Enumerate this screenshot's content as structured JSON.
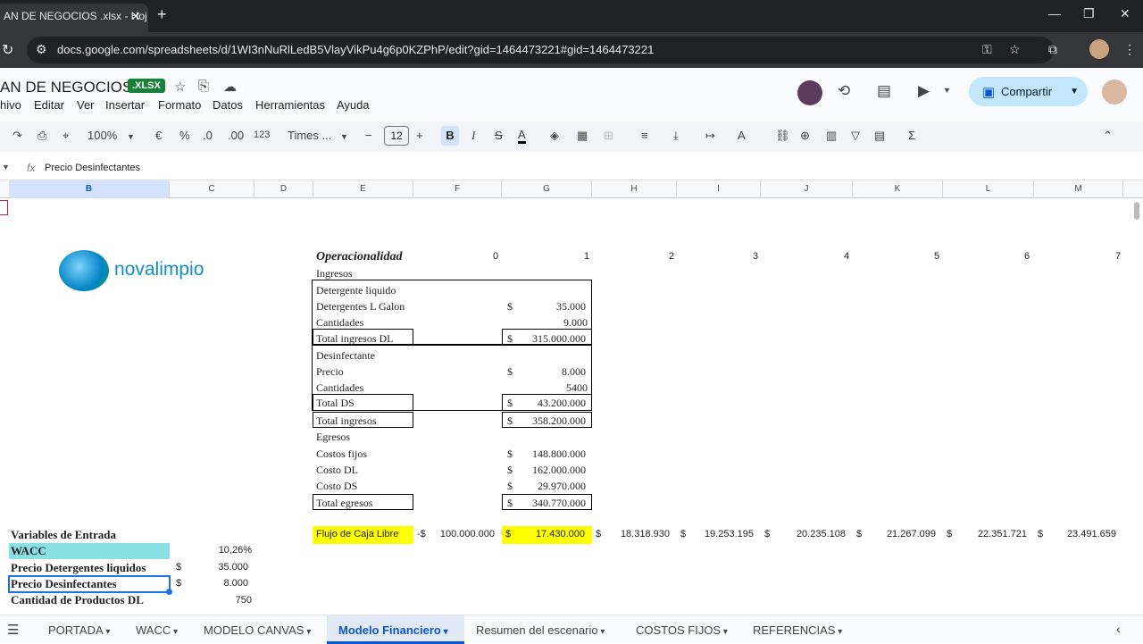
{
  "browser": {
    "tab_title": "AN DE NEGOCIOS .xlsx - Hoj",
    "url": "docs.google.com/spreadsheets/d/1WI3nNuRlLedB5VlayVikPu4g6p0KZPhP/edit?gid=1464473221#gid=1464473221"
  },
  "doc": {
    "title": "AN DE NEGOCIOS",
    "badge": ".XLSX",
    "share_label": "Compartir",
    "menus": [
      "hivo",
      "Editar",
      "Ver",
      "Insertar",
      "Formato",
      "Datos",
      "Herramientas",
      "Ayuda"
    ]
  },
  "toolbar": {
    "zoom": "100%",
    "currency": "€",
    "percent": "%",
    "dec_less": ".0",
    "dec_more": ".00",
    "number_fmt": "123",
    "font": "Times ...",
    "font_size": "12",
    "bold": "B",
    "italic": "I"
  },
  "formula_bar": {
    "fx": "fx",
    "value": "Precio Desinfectantes"
  },
  "columns": [
    "B",
    "C",
    "D",
    "E",
    "F",
    "G",
    "H",
    "I",
    "J",
    "K",
    "L",
    "M"
  ],
  "logo_text": "novalimpio",
  "operacionalidad": {
    "title": "Operacionalidad",
    "periods": [
      "0",
      "1",
      "2",
      "3",
      "4",
      "5",
      "6",
      "7"
    ],
    "ingresos": "Ingresos",
    "detergente": "Detergente liquido",
    "det_galon_label": "Detergentes L Galon",
    "det_galon_value": "35.000",
    "cant1_label": "Cantidades",
    "cant1_value": "9.000",
    "total_dl_label": "Total ingresos DL",
    "total_dl_value": "315.000.000",
    "desinfectante": "Desinfectante",
    "precio_label": "Precio",
    "precio_value": "8.000",
    "cant2_label": "Cantidades",
    "cant2_value": "5400",
    "total_ds_label": "Total DS",
    "total_ds_value": "43.200.000",
    "total_ing_label": "Total ingresos",
    "total_ing_value": "358.200.000",
    "egresos": "Egresos",
    "costos_fijos_label": "Costos fijos",
    "costos_fijos_value": "148.800.000",
    "costo_dl_label": "Costo DL",
    "costo_dl_value": "162.000.000",
    "costo_ds_label": "Costo DS",
    "costo_ds_value": "29.970.000",
    "total_egr_label": "Total egresos",
    "total_egr_value": "340.770.000",
    "currency": "$"
  },
  "flujo": {
    "label": "Flujo de Caja Libre",
    "neg_prefix": "-$",
    "values": [
      "100.000.000",
      "17.430.000",
      "18.318.930",
      "19.253.195",
      "20.235.108",
      "21.267.099",
      "22.351.721",
      "23.491.659"
    ]
  },
  "variables": {
    "title": "Variables de Entrada",
    "wacc_label": "WACC",
    "wacc_value": "10,26%",
    "precio_det_label": "Precio Detergentes liquidos",
    "precio_det_value": "35.000",
    "precio_des_label": "Precio Desinfectantes",
    "precio_des_value": "8.000",
    "cantidad_label": "Cantidad de Productos DL",
    "cantidad_value": "750"
  },
  "sheets": {
    "tabs": [
      "PORTADA",
      "WACC",
      "MODELO CANVAS",
      "Modelo Financiero",
      "Resumen del escenario",
      "COSTOS FIJOS",
      "REFERENCIAS"
    ],
    "active": "Modelo Financiero"
  }
}
